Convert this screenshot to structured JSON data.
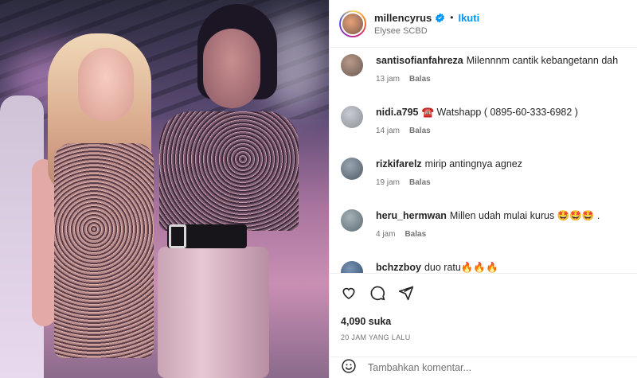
{
  "post": {
    "username": "millencyrus",
    "follow_label": "Ikuti",
    "separator": "•",
    "location": "Elysee SCBD",
    "likes": "4,090 suka",
    "time_ago": "20 JAM YANG LALU"
  },
  "comments": [
    {
      "user": "santisofianfahreza",
      "text": "Milennnm cantik kebangetann dah",
      "age": "13 jam",
      "reply": "Balas",
      "avatar_color": "#6a5a52"
    },
    {
      "user": "nidi.a795",
      "text": "☎️ Watshapp ( 0895-60-333-6982 )",
      "age": "14 jam",
      "reply": "Balas",
      "avatar_color": "#8a8f96"
    },
    {
      "user": "rizkifarelz",
      "text": "mirip antingnya agnez",
      "age": "19 jam",
      "reply": "Balas",
      "avatar_color": "#4d5a66"
    },
    {
      "user": "heru_hermwan",
      "text": "Millen udah mulai kurus 🤩🤩🤩 .",
      "age": "4 jam",
      "reply": "Balas",
      "avatar_color": "#5c6b72"
    },
    {
      "user": "bchzzboy",
      "text": "duo ratu🔥🔥🔥",
      "age": "",
      "reply": "",
      "avatar_color": "#2f4a6a"
    }
  ],
  "add_comment": {
    "placeholder": "Tambahkan komentar..."
  },
  "icons": [
    "like-icon",
    "comment-icon",
    "share-icon",
    "emoji-icon",
    "verified-badge-icon"
  ],
  "colors": {
    "accent": "#0095f6",
    "text": "#262626",
    "muted": "#737373"
  }
}
